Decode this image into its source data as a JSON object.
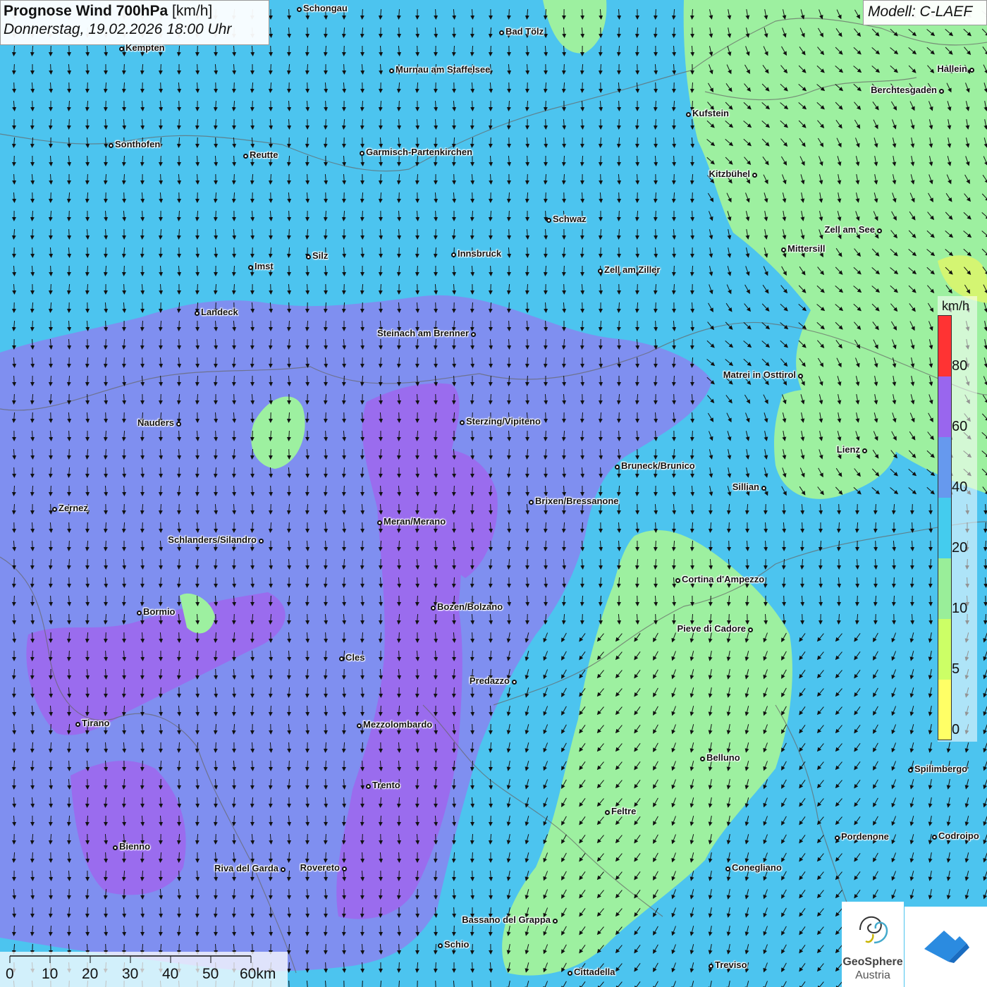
{
  "title": {
    "main": "Prognose Wind 700hPa",
    "unit": "[km/h]",
    "date": "Donnerstag, 19.02.2026 18:00 Uhr"
  },
  "model": "Modell: C-LAEF",
  "legend": {
    "unit": "km/h",
    "labels": [
      "80",
      "60",
      "40",
      "20",
      "10",
      "5",
      "0"
    ],
    "colors": [
      "#ff3333",
      "#9966ee",
      "#6699ee",
      "#44ccee",
      "#99ee99",
      "#ccff66",
      "#ffff66"
    ]
  },
  "scale": {
    "labels": [
      "0",
      "10",
      "20",
      "30",
      "40",
      "50",
      "60km"
    ]
  },
  "logo": {
    "line1": "GeoSphere",
    "line2": "Austria"
  },
  "cities": [
    {
      "name": "Schongau"
    },
    {
      "name": "Bad Tölz"
    },
    {
      "name": "Kempten"
    },
    {
      "name": "Murnau am Staffelsee"
    },
    {
      "name": "Hallein"
    },
    {
      "name": "Berchtesgaden"
    },
    {
      "name": "Kufstein"
    },
    {
      "name": "Sonthofen"
    },
    {
      "name": "Reutte"
    },
    {
      "name": "Garmisch-Partenkirchen"
    },
    {
      "name": "Kitzbühel"
    },
    {
      "name": "Schwaz"
    },
    {
      "name": "Zell am See"
    },
    {
      "name": "Mittersill"
    },
    {
      "name": "Innsbruck"
    },
    {
      "name": "Silz"
    },
    {
      "name": "Imst"
    },
    {
      "name": "Zell am Ziller"
    },
    {
      "name": "Landeck"
    },
    {
      "name": "Steinach am Brenner"
    },
    {
      "name": "Matrei in Osttirol"
    },
    {
      "name": "Nauders"
    },
    {
      "name": "Sterzing/Vipiteno"
    },
    {
      "name": "Lienz"
    },
    {
      "name": "Bruneck/Brunico"
    },
    {
      "name": "Sillian"
    },
    {
      "name": "Brixen/Bressanone"
    },
    {
      "name": "Zernez"
    },
    {
      "name": "Meran/Merano"
    },
    {
      "name": "Schlanders/Silandro"
    },
    {
      "name": "Cortina d'Ampezzo"
    },
    {
      "name": "Bozen/Bolzano"
    },
    {
      "name": "Pieve di Cadore"
    },
    {
      "name": "Bormio"
    },
    {
      "name": "Cles"
    },
    {
      "name": "Predazzo"
    },
    {
      "name": "Tirano"
    },
    {
      "name": "Mezzolombardo"
    },
    {
      "name": "Belluno"
    },
    {
      "name": "Spilimbergo"
    },
    {
      "name": "Trento"
    },
    {
      "name": "Feltre"
    },
    {
      "name": "Pordenone"
    },
    {
      "name": "Codroipo"
    },
    {
      "name": "Bienno"
    },
    {
      "name": "Riva del Garda"
    },
    {
      "name": "Rovereto"
    },
    {
      "name": "Conegliano"
    },
    {
      "name": "Bassano del Grappa"
    },
    {
      "name": "Schio"
    },
    {
      "name": "Treviso"
    },
    {
      "name": "Cittadella"
    }
  ]
}
